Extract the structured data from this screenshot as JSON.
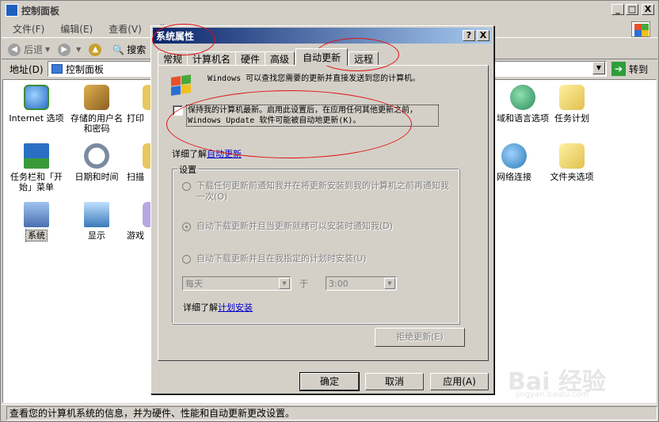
{
  "window": {
    "title": "控制面板",
    "controls": {
      "minimize": "_",
      "maximize": "□",
      "close": "X"
    }
  },
  "menu": {
    "items": [
      "文件(F)",
      "编辑(E)",
      "查看(V)",
      "收"
    ]
  },
  "toolbar": {
    "back_label": "后退",
    "search_label": "搜索"
  },
  "address": {
    "label": "地址(D)",
    "value": "控制面板",
    "go_label": "转到"
  },
  "control_panel_items": [
    {
      "label": "Internet 选项",
      "icon": "internet-options-icon",
      "color": "#3a8d3a"
    },
    {
      "label": "存储的用户名和密码",
      "icon": "stored-passwords-icon",
      "color": "#c08a2a"
    },
    {
      "label": "打印",
      "icon": "printer-icon",
      "color": "#d9b44a"
    },
    {
      "label": "任务栏和「开始」菜单",
      "icon": "taskbar-icon",
      "color": "#2a6fc4"
    },
    {
      "label": "日期和时间",
      "icon": "clock-icon",
      "color": "#7a8aa0"
    },
    {
      "label": "扫描",
      "icon": "scanner-icon",
      "color": "#d9b44a"
    },
    {
      "label": "系统",
      "icon": "system-icon",
      "color": "#4a6fb0"
    },
    {
      "label": "显示",
      "icon": "display-icon",
      "color": "#3a7ab8"
    },
    {
      "label": "游戏",
      "icon": "game-controller-icon",
      "color": "#8a7ab8"
    },
    {
      "label": "域和语言选项",
      "icon": "globe-icon",
      "color": "#2a8a5a"
    },
    {
      "label": "任务计划",
      "icon": "scheduled-tasks-icon",
      "color": "#e0c050"
    },
    {
      "label": "网络连接",
      "icon": "network-icon",
      "color": "#2a7ab0"
    },
    {
      "label": "文件夹选项",
      "icon": "folder-options-icon",
      "color": "#e0c050"
    }
  ],
  "status": {
    "text": "查看您的计算机系统的信息，并为硬件、性能和自动更新更改设置。"
  },
  "dialog": {
    "title": "系统属性",
    "help_btn": "?",
    "close_btn": "X",
    "tabs": [
      "常规",
      "计算机名",
      "硬件",
      "高级",
      "自动更新",
      "远程"
    ],
    "active_tab": "自动更新",
    "intro": "Windows 可以查找您需要的更新并直接发送到您的计算机。",
    "keep_updated": "保持我的计算机最新。启用此设置后，在应用任何其他更新之前，Windows Update 软件可能被自动地更新(K)。",
    "learn_more_prefix": "详细了解",
    "learn_more_link": "自动更新",
    "settings": {
      "title": "设置",
      "option1": "下载任何更新前通知我并在将更新安装到我的计算机之前再通知我一次(O)",
      "option2": "自动下载更新并且当更新就绪可以安装时通知我(D)",
      "option3": "自动下载更新并且在我指定的计划时安装(U)",
      "selected_option": 2,
      "day_value": "每天",
      "at_label": "于",
      "time_value": "3:00",
      "learn_more_prefix": "详细了解",
      "learn_more_link": "计划安装"
    },
    "decline_button": "拒绝更新(E)",
    "ok_button": "确定",
    "cancel_button": "取消",
    "apply_button": "应用(A)"
  },
  "annotation_color": "#e01010"
}
